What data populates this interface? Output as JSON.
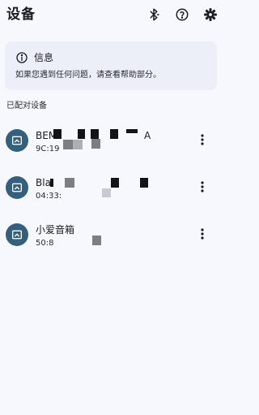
{
  "header": {
    "title": "设备",
    "actions": [
      {
        "name": "bluetooth-icon"
      },
      {
        "name": "help-icon"
      },
      {
        "name": "settings-icon"
      }
    ]
  },
  "info": {
    "title": "信息",
    "body": "如果您遇到任何问题，请查看帮助部分。"
  },
  "paired": {
    "section_title": "已配对设备",
    "devices": [
      {
        "name": "BEM",
        "name_tail": "A",
        "address": "9C:19"
      },
      {
        "name": "Bla",
        "name_tail": "",
        "address": "04:33:"
      },
      {
        "name": "小爱音箱",
        "name_tail": "",
        "address": "50:8"
      }
    ]
  },
  "colors": {
    "background": "#f7f8fd",
    "card": "#eceef8",
    "avatar": "#355f7e"
  }
}
